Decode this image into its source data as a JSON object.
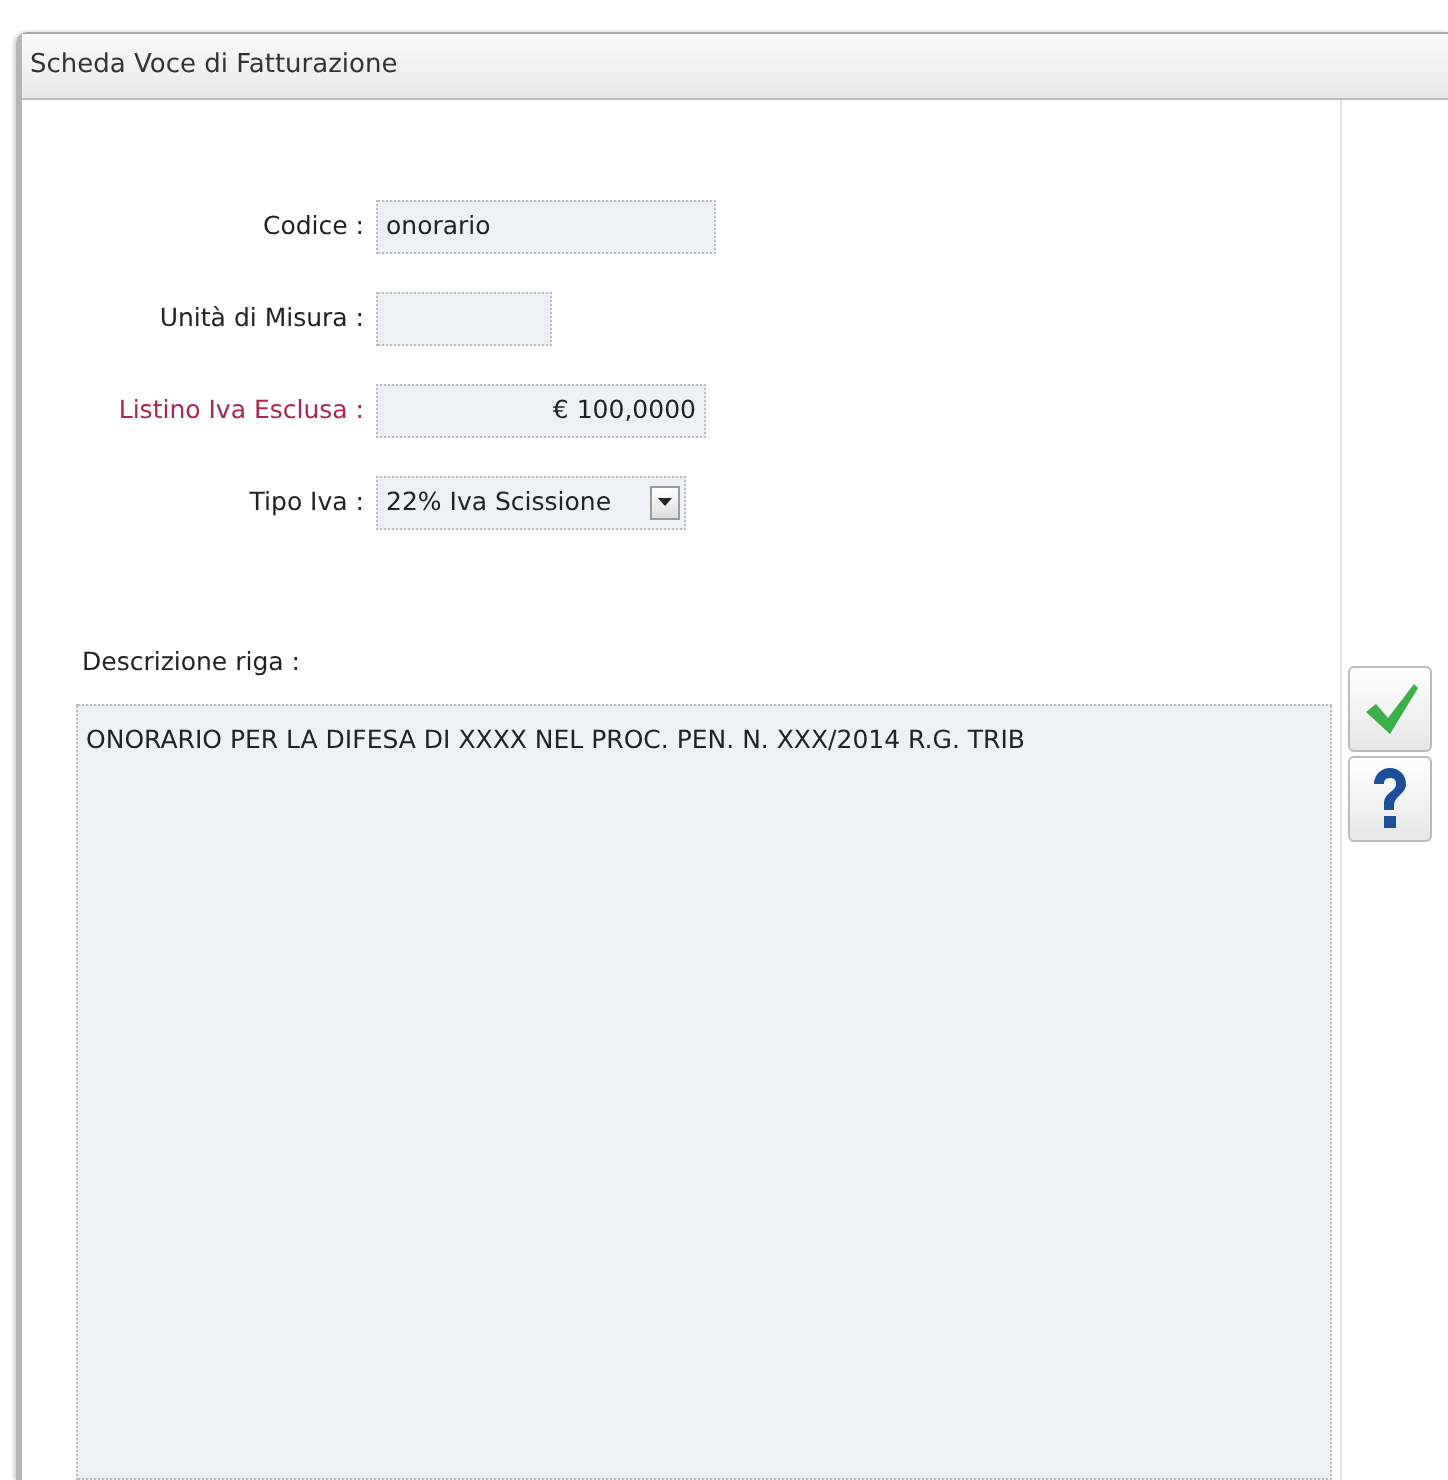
{
  "window": {
    "title": "Scheda Voce di Fatturazione"
  },
  "fields": [
    {
      "kind": "text",
      "label": "Codice :",
      "value": "onorario",
      "required": false
    },
    {
      "kind": "text",
      "label": "Unità di Misura :",
      "required": false
    },
    {
      "kind": "amount",
      "label": "Listino Iva Esclusa :",
      "value": "€ 100,0000",
      "required": true
    },
    {
      "kind": "select",
      "label": "Tipo Iva :",
      "value": "22% Iva Scissione",
      "required": false
    }
  ],
  "description": {
    "label": "Descrizione riga :",
    "value": "ONORARIO PER LA DIFESA DI XXXX NEL PROC. PEN. N. XXX/2014 R.G. TRIB"
  },
  "buttons": [
    {
      "kind": "confirm"
    },
    {
      "kind": "help"
    }
  ]
}
